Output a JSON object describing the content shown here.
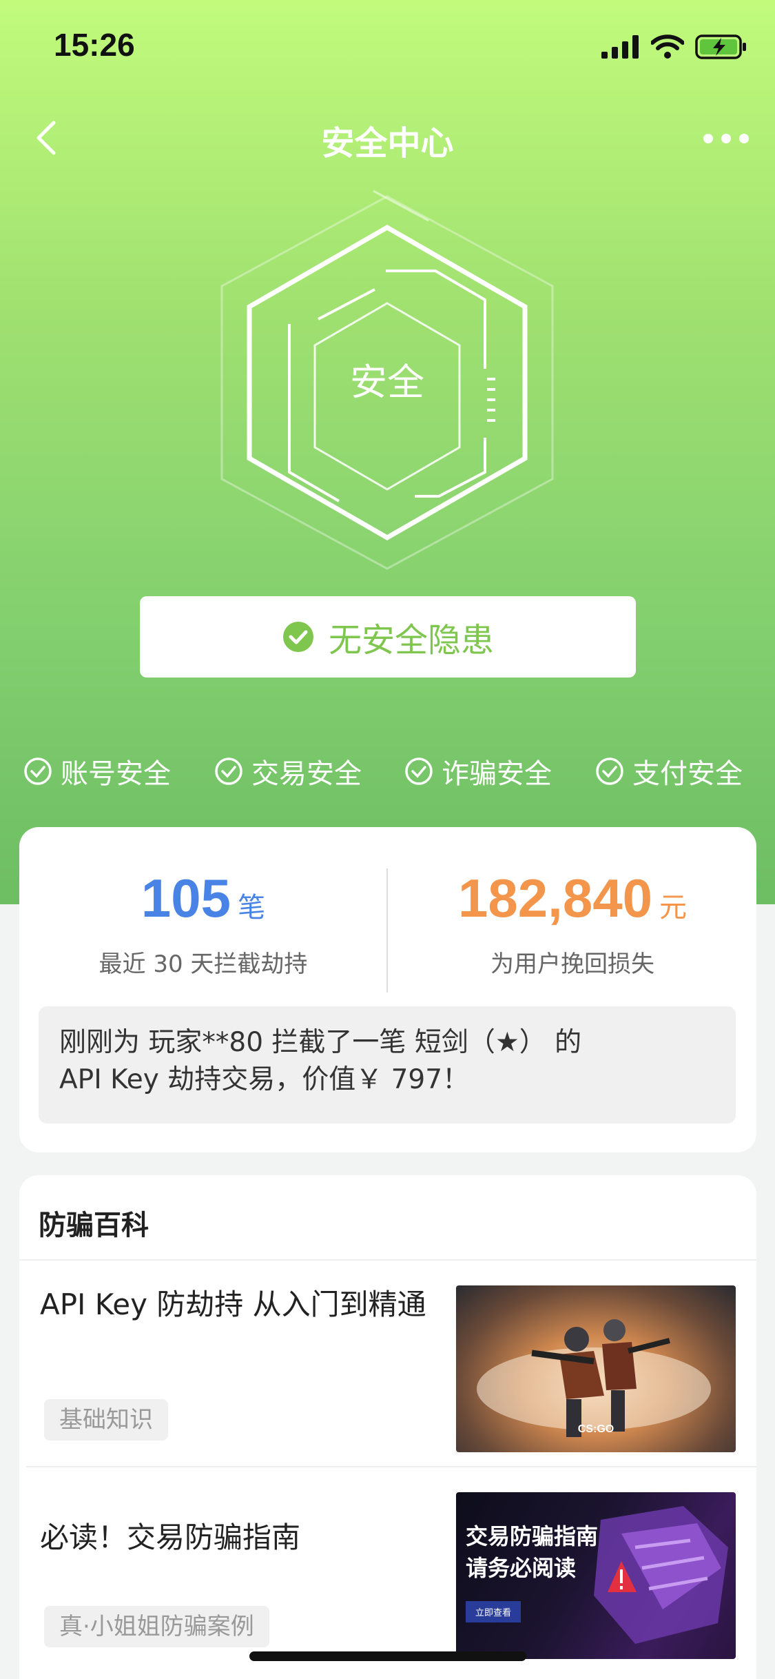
{
  "status_bar": {
    "time": "15:26"
  },
  "nav": {
    "title": "安全中心"
  },
  "shield": {
    "label": "安全"
  },
  "status_button": {
    "label": "无安全隐患"
  },
  "checks": [
    {
      "label": "账号安全"
    },
    {
      "label": "交易安全"
    },
    {
      "label": "诈骗安全"
    },
    {
      "label": "支付安全"
    }
  ],
  "stats": {
    "intercepted": {
      "value": "105",
      "unit": "笔",
      "desc": "最近 30 天拦截劫持",
      "color": "#4a83e6"
    },
    "recovered": {
      "value": "182,840",
      "unit": "元",
      "desc": "为用户挽回损失",
      "color": "#f3954a"
    }
  },
  "ticker": {
    "line1": "刚刚为 玩家**80 拦截了一笔 短剑（★） 的",
    "line2": "API Key 劫持交易，价值￥ 797！"
  },
  "wiki": {
    "title": "防骗百科",
    "articles": [
      {
        "title": "API Key 防劫持 从入门到精通",
        "tag": "基础知识",
        "image_caption": "CS:GO"
      },
      {
        "title": "必读！交易防骗指南",
        "tag": "真·小姐姐防骗案例",
        "image_line1": "交易防骗指南",
        "image_line2": "请务必阅读",
        "image_button": "立即查看"
      }
    ]
  },
  "colors": {
    "accent_green": "#7fc64f",
    "blue": "#4a83e6",
    "orange": "#f3954a"
  }
}
